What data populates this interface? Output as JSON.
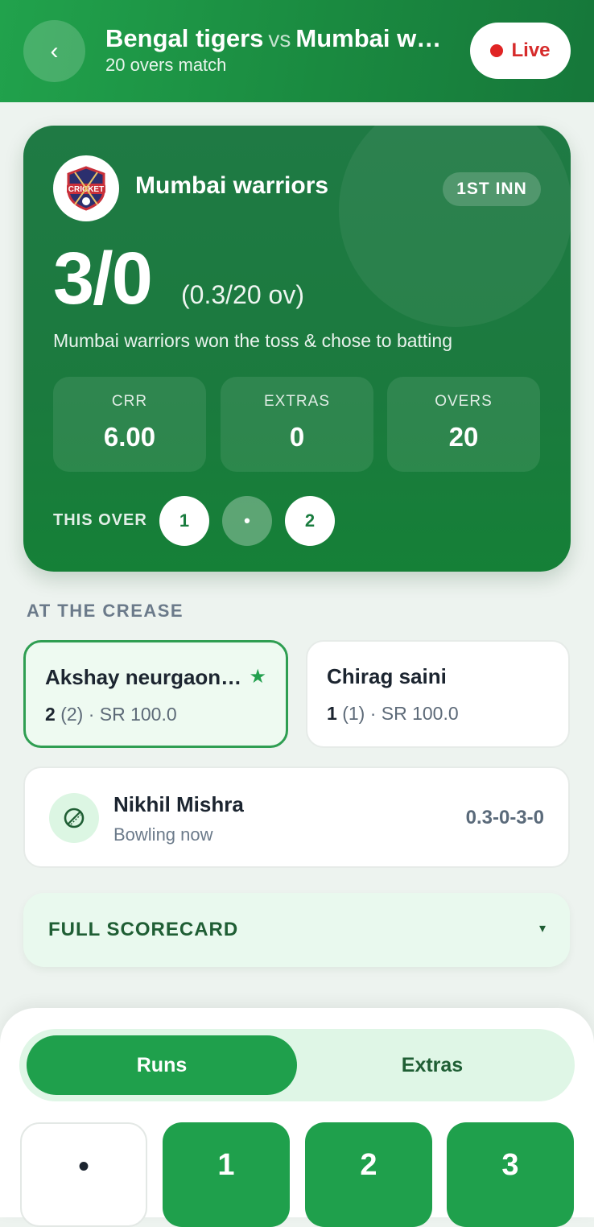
{
  "header": {
    "team_a": "Bengal tigers",
    "vs": "vs",
    "team_b": "Mumbai warriors",
    "subtitle": "20 overs match",
    "live_label": "Live",
    "back_icon": "chevron-left-icon"
  },
  "score_card": {
    "team_name": "Mumbai warriors",
    "innings_badge": "1ST INN",
    "score": "3/0",
    "overs": "(0.3/20 ov)",
    "toss_text": "Mumbai warriors won the toss & chose to batting",
    "stats": [
      {
        "label": "CRR",
        "value": "6.00"
      },
      {
        "label": "EXTRAS",
        "value": "0"
      },
      {
        "label": "OVERS",
        "value": "20"
      }
    ],
    "this_over_label": "THIS OVER",
    "this_over": [
      "1",
      "•",
      "2"
    ]
  },
  "crease": {
    "section_label": "AT THE CREASE",
    "striker": {
      "name": "Akshay neurgaonkar",
      "runs": "2",
      "balls": "(2)",
      "sr": "· SR 100.0"
    },
    "non_striker": {
      "name": "Chirag saini",
      "runs": "1",
      "balls": "(1)",
      "sr": "· SR 100.0"
    }
  },
  "bowler": {
    "name": "Nikhil Mishra",
    "status": "Bowling now",
    "figures": "0.3-0-3-0"
  },
  "scorecard": {
    "label": "FULL SCORECARD",
    "arrow": "▾"
  },
  "input_panel": {
    "tabs": [
      "Runs",
      "Extras"
    ],
    "active_tab": "Runs",
    "run_keys": [
      "•",
      "1",
      "2",
      "3"
    ]
  },
  "colors": {
    "primary_green": "#1fa04c",
    "dark_green": "#1b7a3e",
    "live_red": "#e02424"
  }
}
